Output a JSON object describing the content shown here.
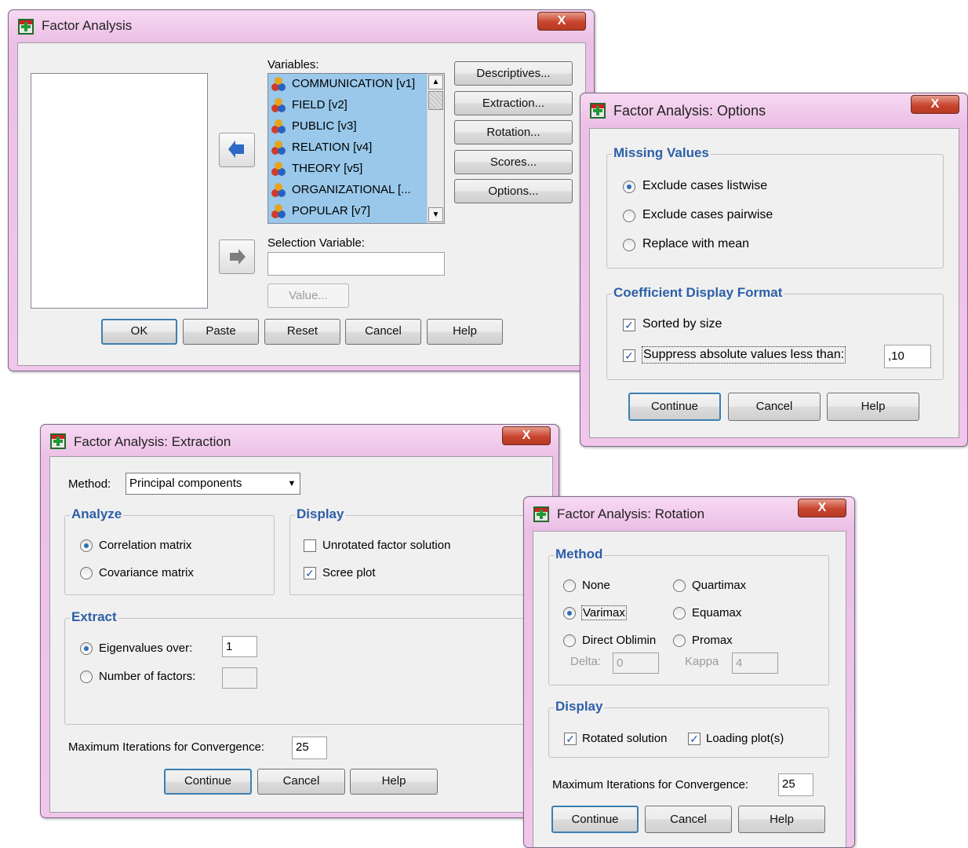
{
  "main": {
    "title": "Factor Analysis",
    "close_label": "X",
    "variables_label": "Variables:",
    "variables": [
      "COMMUNICATION [v1]",
      "FIELD [v2]",
      "PUBLIC [v3]",
      "RELATION [v4]",
      "THEORY [v5]",
      "ORGANIZATIONAL [...",
      "POPULAR [v7]"
    ],
    "selection_label": "Selection Variable:",
    "value_button": "Value...",
    "side_buttons": [
      "Descriptives...",
      "Extraction...",
      "Rotation...",
      "Scores...",
      "Options..."
    ],
    "bottom_buttons": [
      "OK",
      "Paste",
      "Reset",
      "Cancel",
      "Help"
    ]
  },
  "options": {
    "title": "Factor Analysis: Options",
    "close_label": "X",
    "missing_label": "Missing Values",
    "missing_options": [
      "Exclude cases listwise",
      "Exclude cases pairwise",
      "Replace with mean"
    ],
    "missing_selected": 0,
    "coef_label": "Coefficient Display Format",
    "sorted_label": "Sorted by size",
    "sorted_checked": true,
    "suppress_label": "Suppress absolute values less than:",
    "suppress_checked": true,
    "suppress_value": ",10",
    "buttons": [
      "Continue",
      "Cancel",
      "Help"
    ]
  },
  "extraction": {
    "title": "Factor Analysis: Extraction",
    "close_label": "X",
    "method_label": "Method:",
    "method_value": "Principal components",
    "analyze_label": "Analyze",
    "analyze_options": [
      "Correlation matrix",
      "Covariance matrix"
    ],
    "analyze_selected": 0,
    "display_label": "Display",
    "unrotated_label": "Unrotated factor solution",
    "unrotated_checked": false,
    "scree_label": "Scree plot",
    "scree_checked": true,
    "extract_label": "Extract",
    "eigen_label": "Eigenvalues over:",
    "eigen_value": "1",
    "nfactors_label": "Number of factors:",
    "nfactors_value": "",
    "extract_selected": 0,
    "maxiter_label": "Maximum Iterations for Convergence:",
    "maxiter_value": "25",
    "buttons": [
      "Continue",
      "Cancel",
      "Help"
    ]
  },
  "rotation": {
    "title": "Factor Analysis: Rotation",
    "close_label": "X",
    "method_label": "Method",
    "methods": [
      "None",
      "Quartimax",
      "Varimax",
      "Equamax",
      "Direct Oblimin",
      "Promax"
    ],
    "method_selected": "Varimax",
    "delta_label": "Delta:",
    "delta_value": "0",
    "kappa_label": "Kappa",
    "kappa_value": "4",
    "display_label": "Display",
    "rotated_label": "Rotated solution",
    "rotated_checked": true,
    "loading_label": "Loading plot(s)",
    "loading_checked": true,
    "maxiter_label": "Maximum Iterations for Convergence:",
    "maxiter_value": "25",
    "buttons": [
      "Continue",
      "Cancel",
      "Help"
    ]
  }
}
